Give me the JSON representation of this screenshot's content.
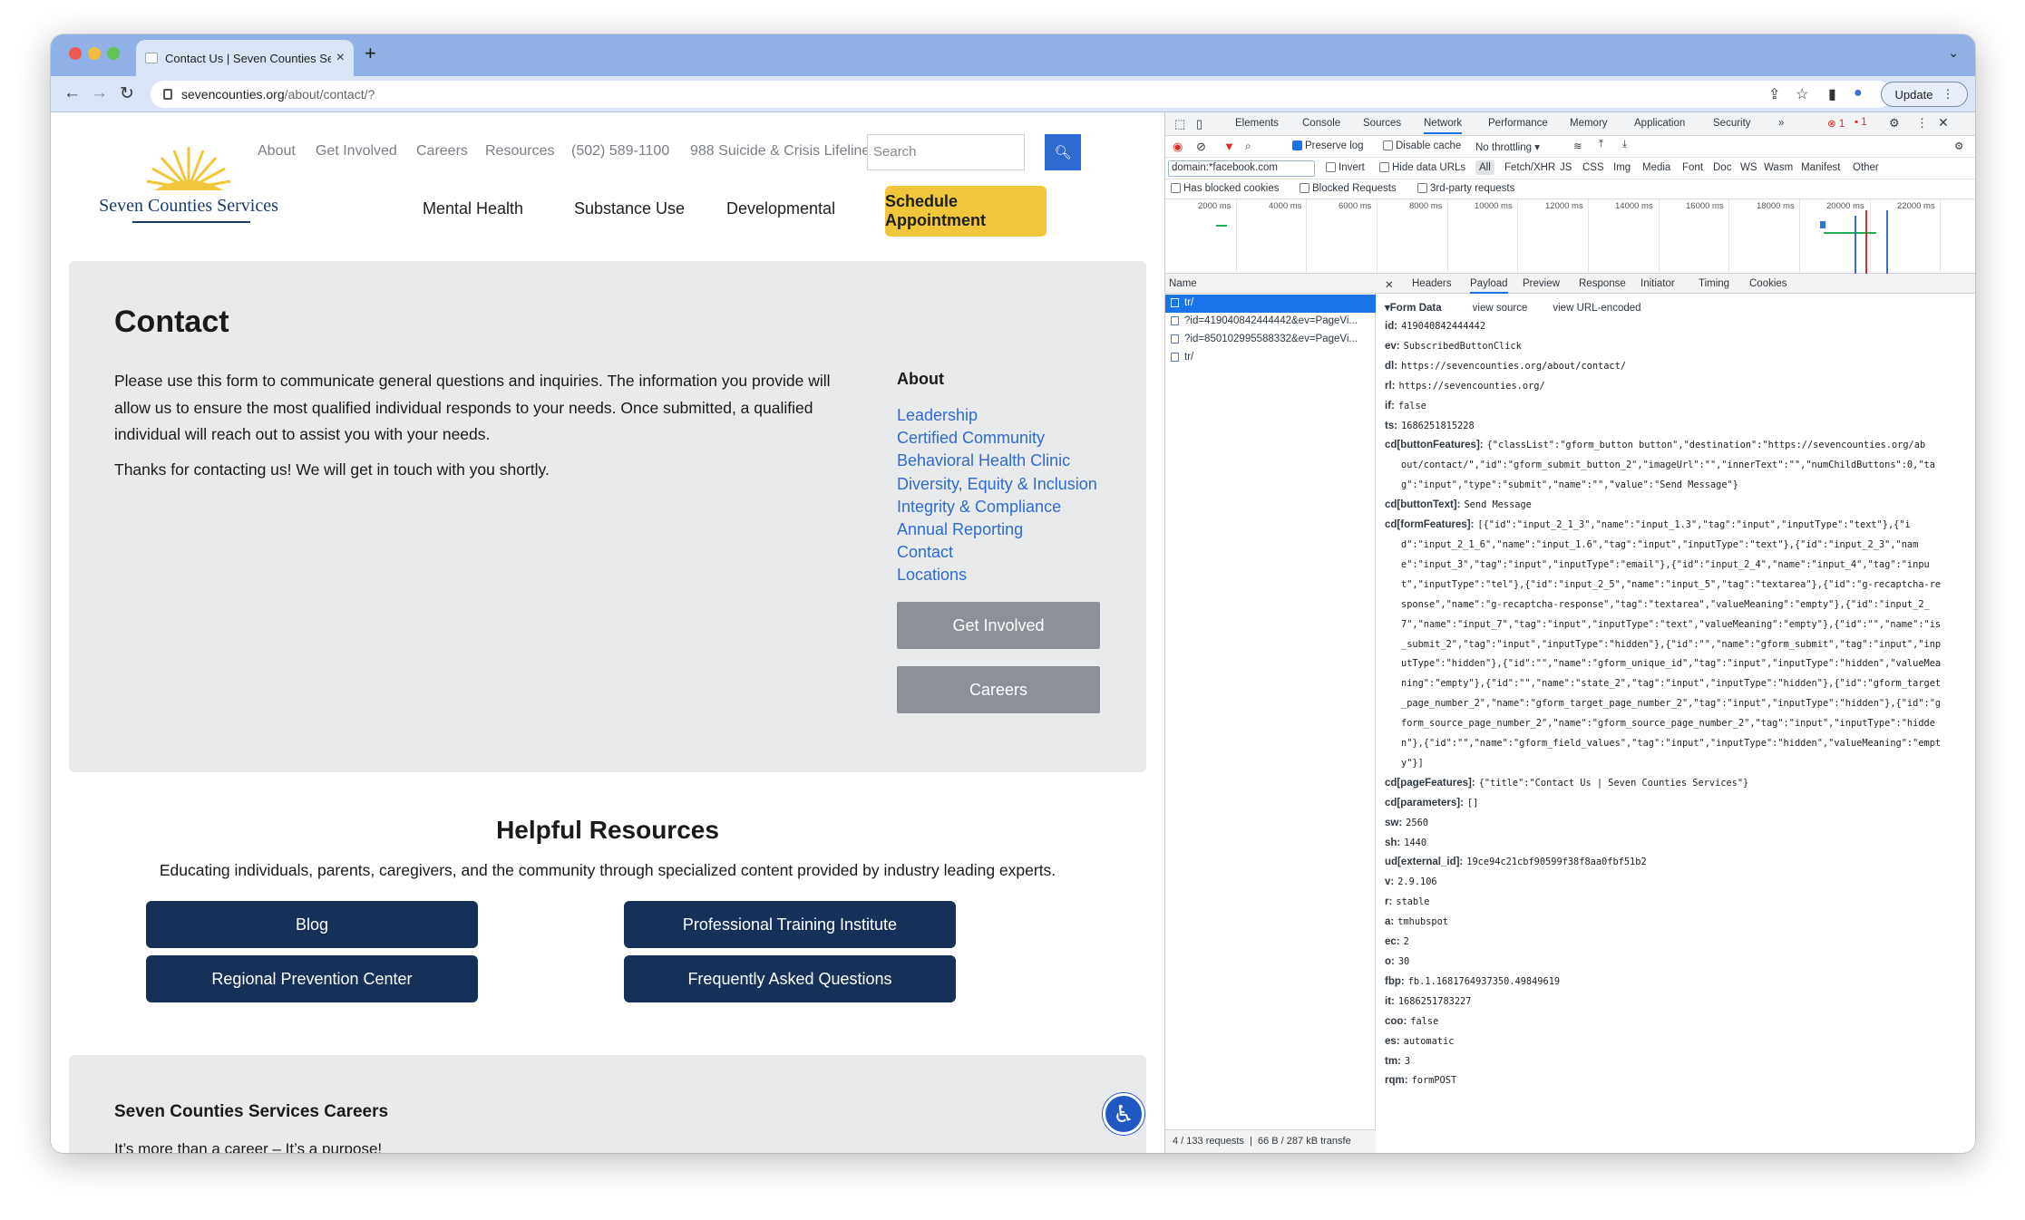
{
  "browser": {
    "tab_title": "Contact Us | Seven Counties Se",
    "url_host": "sevencounties.org",
    "url_path": "/about/contact/?",
    "update_label": "Update"
  },
  "site": {
    "logo_name": "Seven Counties Services",
    "top_nav": [
      "About",
      "Get Involved",
      "Careers",
      "Resources",
      "(502) 589-1100",
      "988 Suicide & Crisis Lifeline"
    ],
    "search_placeholder": "Search",
    "main_nav": [
      "Mental Health",
      "Substance Use",
      "Developmental"
    ],
    "schedule_label": "Schedule Appointment",
    "contact_title": "Contact",
    "contact_para": "Please use this form to communicate general questions and inquiries. The information you provide will allow us to ensure the most qualified individual responds to your needs. Once submitted, a qualified individual will reach out to assist you with your needs.",
    "contact_thanks": "Thanks for contacting us! We will get in touch with you shortly.",
    "about_heading": "About",
    "about_links": [
      "Leadership",
      "Certified Community",
      "Behavioral Health Clinic",
      "Diversity, Equity & Inclusion",
      "Integrity & Compliance",
      "Annual Reporting",
      "Contact",
      "Locations"
    ],
    "get_involved_btn": "Get Involved",
    "careers_btn": "Careers",
    "helpful_title": "Helpful Resources",
    "helpful_sub": "Educating individuals, parents, caregivers, and the community through specialized content provided by industry leading experts.",
    "resource_buttons": [
      "Blog",
      "Professional Training Institute",
      "Regional Prevention Center",
      "Frequently Asked Questions"
    ],
    "careers_title": "Seven Counties Services Careers",
    "careers_sub": "It’s more than a career – It’s a purpose!"
  },
  "devtools": {
    "tabs": [
      "Elements",
      "Console",
      "Sources",
      "Network",
      "Performance",
      "Memory",
      "Application",
      "Security"
    ],
    "error_count": "1",
    "warn_count": "1",
    "preserve_log": "Preserve log",
    "disable_cache": "Disable cache",
    "throttling": "No throttling",
    "filter_value": "domain:*facebook.com",
    "filter_opts": [
      "Invert",
      "Hide data URLs",
      "All",
      "Fetch/XHR",
      "JS",
      "CSS",
      "Img",
      "Media",
      "Font",
      "Doc",
      "WS",
      "Wasm",
      "Manifest",
      "Other"
    ],
    "row3_opts": [
      "Has blocked cookies",
      "Blocked Requests",
      "3rd-party requests"
    ],
    "timeline_ticks": [
      "2000 ms",
      "4000 ms",
      "6000 ms",
      "8000 ms",
      "10000 ms",
      "12000 ms",
      "14000 ms",
      "16000 ms",
      "18000 ms",
      "20000 ms",
      "22000 ms"
    ],
    "name_header": "Name",
    "requests": [
      "tr/",
      "?id=419040842444442&ev=PageVi...",
      "?id=850102995588332&ev=PageVi...",
      "tr/"
    ],
    "footer_requests": "4 / 133 requests",
    "footer_transfer": "66 B / 287 kB transfe",
    "detail_tabs": [
      "Headers",
      "Payload",
      "Preview",
      "Response",
      "Initiator",
      "Timing",
      "Cookies"
    ],
    "form_data_label": "Form Data",
    "view_source": "view source",
    "view_url_encoded": "view URL-encoded",
    "payload": [
      {
        "k": "id:",
        "v": "419040842444442"
      },
      {
        "k": "ev:",
        "v": "SubscribedButtonClick"
      },
      {
        "k": "dl:",
        "v": "https://sevencounties.org/about/contact/"
      },
      {
        "k": "rl:",
        "v": "https://sevencounties.org/"
      },
      {
        "k": "if:",
        "v": "false"
      },
      {
        "k": "ts:",
        "v": "1686251815228"
      },
      {
        "k": "cd[buttonFeatures]:",
        "v": "{\"classList\":\"gform_button button\",\"destination\":\"https://sevencounties.org/ab"
      },
      {
        "k": "",
        "v": "out/contact/\",\"id\":\"gform_submit_button_2\",\"imageUrl\":\"\",\"innerText\":\"\",\"numChildButtons\":0,\"ta"
      },
      {
        "k": "",
        "v": "g\":\"input\",\"type\":\"submit\",\"name\":\"\",\"value\":\"Send Message\"}"
      },
      {
        "k": "cd[buttonText]:",
        "v": "Send Message"
      },
      {
        "k": "cd[formFeatures]:",
        "v": "[{\"id\":\"input_2_1_3\",\"name\":\"input_1.3\",\"tag\":\"input\",\"inputType\":\"text\"},{\"i"
      },
      {
        "k": "",
        "v": "d\":\"input_2_1_6\",\"name\":\"input_1.6\",\"tag\":\"input\",\"inputType\":\"text\"},{\"id\":\"input_2_3\",\"nam"
      },
      {
        "k": "",
        "v": "e\":\"input_3\",\"tag\":\"input\",\"inputType\":\"email\"},{\"id\":\"input_2_4\",\"name\":\"input_4\",\"tag\":\"inpu"
      },
      {
        "k": "",
        "v": "t\",\"inputType\":\"tel\"},{\"id\":\"input_2_5\",\"name\":\"input_5\",\"tag\":\"textarea\"},{\"id\":\"g-recaptcha-re"
      },
      {
        "k": "",
        "v": "sponse\",\"name\":\"g-recaptcha-response\",\"tag\":\"textarea\",\"valueMeaning\":\"empty\"},{\"id\":\"input_2_"
      },
      {
        "k": "",
        "v": "7\",\"name\":\"input_7\",\"tag\":\"input\",\"inputType\":\"text\",\"valueMeaning\":\"empty\"},{\"id\":\"\",\"name\":\"is"
      },
      {
        "k": "",
        "v": "_submit_2\",\"tag\":\"input\",\"inputType\":\"hidden\"},{\"id\":\"\",\"name\":\"gform_submit\",\"tag\":\"input\",\"inp"
      },
      {
        "k": "",
        "v": "utType\":\"hidden\"},{\"id\":\"\",\"name\":\"gform_unique_id\",\"tag\":\"input\",\"inputType\":\"hidden\",\"valueMea"
      },
      {
        "k": "",
        "v": "ning\":\"empty\"},{\"id\":\"\",\"name\":\"state_2\",\"tag\":\"input\",\"inputType\":\"hidden\"},{\"id\":\"gform_target"
      },
      {
        "k": "",
        "v": "_page_number_2\",\"name\":\"gform_target_page_number_2\",\"tag\":\"input\",\"inputType\":\"hidden\"},{\"id\":\"g"
      },
      {
        "k": "",
        "v": "form_source_page_number_2\",\"name\":\"gform_source_page_number_2\",\"tag\":\"input\",\"inputType\":\"hidde"
      },
      {
        "k": "",
        "v": "n\"},{\"id\":\"\",\"name\":\"gform_field_values\",\"tag\":\"input\",\"inputType\":\"hidden\",\"valueMeaning\":\"empt"
      },
      {
        "k": "",
        "v": "y\"}]"
      },
      {
        "k": "cd[pageFeatures]:",
        "v": "{\"title\":\"Contact Us | Seven Counties Services\"}"
      },
      {
        "k": "cd[parameters]:",
        "v": "[]"
      },
      {
        "k": "sw:",
        "v": "2560"
      },
      {
        "k": "sh:",
        "v": "1440"
      },
      {
        "k": "ud[external_id]:",
        "v": "19ce94c21cbf90599f38f8aa0fbf51b2"
      },
      {
        "k": "v:",
        "v": "2.9.106"
      },
      {
        "k": "r:",
        "v": "stable"
      },
      {
        "k": "a:",
        "v": "tmhubspot"
      },
      {
        "k": "ec:",
        "v": "2"
      },
      {
        "k": "o:",
        "v": "30"
      },
      {
        "k": "fbp:",
        "v": "fb.1.1681764937350.49849619"
      },
      {
        "k": "it:",
        "v": "1686251783227"
      },
      {
        "k": "coo:",
        "v": "false"
      },
      {
        "k": "es:",
        "v": "automatic"
      },
      {
        "k": "tm:",
        "v": "3"
      },
      {
        "k": "rqm:",
        "v": "formPOST"
      }
    ]
  },
  "colors": {
    "brand_navy": "#16305a",
    "schedule_yellow": "#f2c63b",
    "link_blue": "#2e6bd1",
    "devtools_accent": "#1a73e8"
  }
}
